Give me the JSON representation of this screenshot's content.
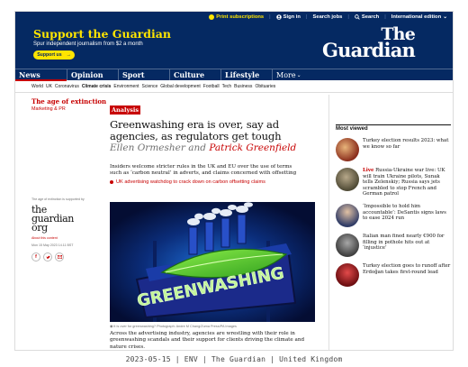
{
  "masthead": {
    "topbar": {
      "print": "Print subscriptions",
      "signin": "Sign in",
      "jobs": "Search jobs",
      "search": "Search",
      "edition": "International edition"
    },
    "support_title": "Support the Guardian",
    "support_sub": "Spur independent journalism from $2 a month",
    "support_button": "Support us",
    "logo_line1": "The",
    "logo_line2": "Guardian"
  },
  "nav": {
    "pillars": [
      "News",
      "Opinion",
      "Sport",
      "Culture",
      "Lifestyle"
    ],
    "more": "More",
    "sub": [
      "World",
      "UK",
      "Coronavirus",
      "Climate crisis",
      "Environment",
      "Science",
      "Global development",
      "Football",
      "Tech",
      "Business",
      "Obituaries"
    ]
  },
  "left": {
    "series": "The age of extinction",
    "series_sub": "Marketing & PR",
    "supported_by": "The age of extinction is supported by",
    "supporter_logo": "the guardian org",
    "about": "About this content",
    "date": "Mon 15 May 2023 14.11 BST"
  },
  "article": {
    "kicker": "Analysis",
    "headline": "Greenwashing era is over, say ad agencies, as regulators get tough",
    "byline_a": "Ellen Ormesher",
    "byline_and": " and ",
    "byline_b": "Patrick Greenfield",
    "standfirst": "Insiders welcome stricter rules in the UK and EU over the use of terms such as ‘carbon neutral’ in adverts, and claims concerned with offsetting",
    "related": "UK advertising watchdog to crack down on carbon offsetting claims",
    "image_text": "GREENWASHING",
    "caption": "It is over for greenwashing? Photograph: Andre M Chang/Zuma Press/PA Images",
    "body": "Across the advertising industry, agencies are wrestling with their role in greenwashing scandals and their support for clients driving the climate and nature crises."
  },
  "most_viewed": {
    "title": "Most viewed",
    "items": [
      {
        "live": "",
        "text": "Turkey election results 2023: what we know so far",
        "color": "#8a2d1c"
      },
      {
        "live": "Live",
        "text": " Russia-Ukraine war live: UK will train Ukraine pilots, Sunak tells Zelenskiy; Russia says jets scrambled to stop French and German patrol",
        "color": "#6a6048"
      },
      {
        "live": "",
        "text": "‘Impossible to hold him accountable’: DeSantis signs laws to ease 2024 run",
        "color": "#c9a98a"
      },
      {
        "live": "",
        "text": "Italian man fined nearly €900 for filling in pothole hits out at ‘injustice’",
        "color": "#6e6e6e"
      },
      {
        "live": "",
        "text": "Turkey election goes to runoff after Erdoğan takes first-round lead",
        "color": "#a4161a"
      }
    ]
  },
  "footer": "2023-05-15 | ENV | The Guardian | United Kingdom",
  "colors": {
    "brand_blue": "#052962",
    "accent_yellow": "#ffe500",
    "news_red": "#c70000"
  }
}
